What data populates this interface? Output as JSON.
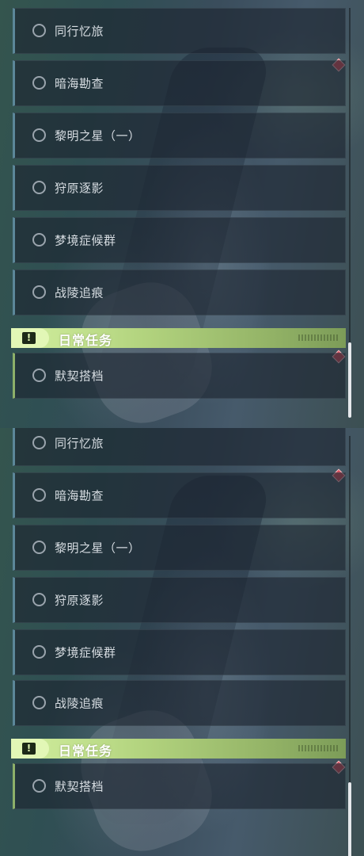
{
  "views": [
    {
      "quests": [
        {
          "label": "同行忆旅"
        },
        {
          "label": "暗海勘查"
        },
        {
          "label": "黎明之星（一）"
        },
        {
          "label": "狩原逐影"
        },
        {
          "label": "梦境症候群"
        },
        {
          "label": "战陵追痕"
        }
      ],
      "daily_header": {
        "title": "日常任务",
        "icon": "exclamation-icon"
      },
      "daily_quests": [
        {
          "label": "默契搭档"
        }
      ]
    },
    {
      "quests": [
        {
          "label": "同行忆旅"
        },
        {
          "label": "暗海勘查"
        },
        {
          "label": "黎明之星（一）"
        },
        {
          "label": "狩原逐影"
        },
        {
          "label": "梦境症候群"
        },
        {
          "label": "战陵追痕"
        }
      ],
      "daily_header": {
        "title": "日常任务",
        "icon": "exclamation-icon"
      },
      "daily_quests": [
        {
          "label": "默契搭档"
        }
      ]
    }
  ],
  "colors": {
    "quest_accent": "#5c8799",
    "daily_accent": "#8db06a",
    "header_green": "#b2d37e",
    "marker_red": "#d8505e"
  }
}
